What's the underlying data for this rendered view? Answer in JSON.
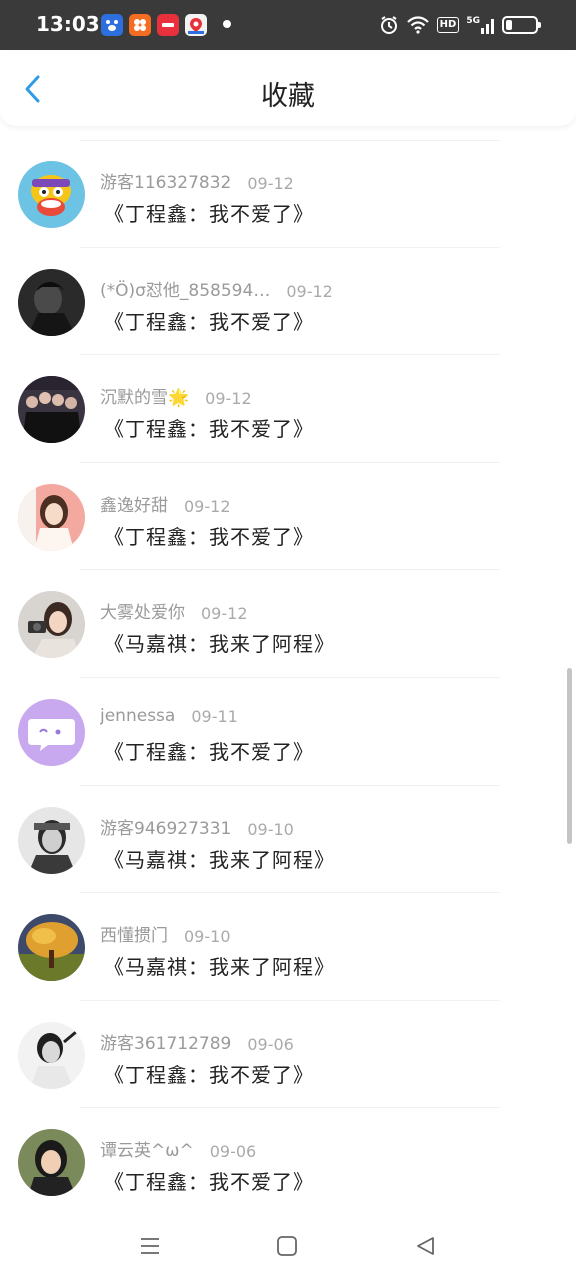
{
  "status_bar": {
    "time": "13:03",
    "hd_label": "HD",
    "network_label": "5G",
    "battery_level": 0.22,
    "icons": [
      "baidu-app-icon",
      "orange-app-icon",
      "red-app-icon",
      "map-app-icon",
      "alarm-icon",
      "wifi-icon",
      "signal-icon",
      "battery-icon"
    ]
  },
  "header": {
    "title": "收藏",
    "back_icon": "chevron-left-icon",
    "accent_color": "#2f9ce8"
  },
  "favorites": [
    {
      "name": "游客116327832",
      "date": "09-12",
      "title": "《丁程鑫：我不爱了》"
    },
    {
      "name": "(*Ö)σ怼他_858594…",
      "date": "09-12",
      "title": "《丁程鑫：我不爱了》"
    },
    {
      "name": "沉默的雪🌟",
      "date": "09-12",
      "title": "《丁程鑫：我不爱了》"
    },
    {
      "name": "鑫逸好甜",
      "date": "09-12",
      "title": "《丁程鑫：我不爱了》"
    },
    {
      "name": "大雾处爱你",
      "date": "09-12",
      "title": "《马嘉祺：我来了阿程》"
    },
    {
      "name": "jennessa",
      "date": "09-11",
      "title": "《丁程鑫：我不爱了》"
    },
    {
      "name": "游客946927331",
      "date": "09-10",
      "title": "《马嘉祺：我来了阿程》"
    },
    {
      "name": "西懂掼门",
      "date": "09-10",
      "title": "《马嘉祺：我来了阿程》"
    },
    {
      "name": "游客361712789",
      "date": "09-06",
      "title": "《丁程鑫：我不爱了》"
    },
    {
      "name": "谭云英^ω^",
      "date": "09-06",
      "title": "《丁程鑫：我不爱了》"
    }
  ],
  "nav_bar": {
    "icons": [
      "menu-icon",
      "home-square-icon",
      "back-triangle-icon"
    ]
  }
}
